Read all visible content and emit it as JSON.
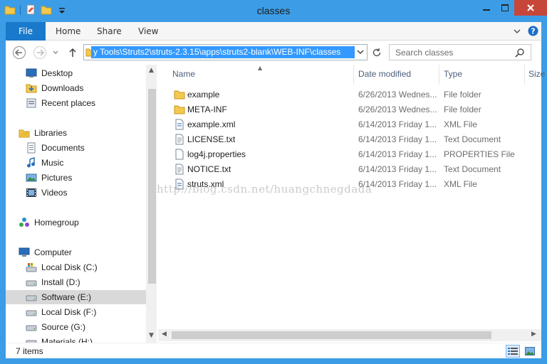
{
  "window": {
    "title": "classes",
    "colors": {
      "frame": "#3c9de6",
      "file_tab": "#1979ca",
      "close": "#c7463a",
      "selection": "#3399ff"
    }
  },
  "ribbon": {
    "tabs": [
      "File",
      "Home",
      "Share",
      "View"
    ]
  },
  "navbar": {
    "address": "y Tools\\Struts2\\struts-2.3.15\\apps\\struts2-blank\\WEB-INF\\classes",
    "search_placeholder": "Search classes"
  },
  "nav_pane": {
    "items": [
      {
        "label": "Desktop",
        "icon": "desktop-icon"
      },
      {
        "label": "Downloads",
        "icon": "downloads-icon"
      },
      {
        "label": "Recent places",
        "icon": "recent-places-icon"
      },
      {
        "label": "Libraries",
        "icon": "libraries-icon"
      },
      {
        "label": "Documents",
        "icon": "documents-icon"
      },
      {
        "label": "Music",
        "icon": "music-icon"
      },
      {
        "label": "Pictures",
        "icon": "pictures-icon"
      },
      {
        "label": "Videos",
        "icon": "videos-icon"
      },
      {
        "label": "Homegroup",
        "icon": "homegroup-icon"
      },
      {
        "label": "Computer",
        "icon": "computer-icon"
      },
      {
        "label": "Local Disk (C:)",
        "icon": "system-drive-icon"
      },
      {
        "label": "Install (D:)",
        "icon": "drive-icon"
      },
      {
        "label": "Software (E:)",
        "icon": "drive-icon",
        "selected": true
      },
      {
        "label": "Local Disk (F:)",
        "icon": "drive-icon"
      },
      {
        "label": "Source (G:)",
        "icon": "drive-icon"
      },
      {
        "label": "Materials (H:)",
        "icon": "drive-icon"
      }
    ]
  },
  "file_list": {
    "columns": [
      "Name",
      "Date modified",
      "Type",
      "Size"
    ],
    "rows": [
      {
        "name": "example",
        "date": "6/26/2013 Wednes...",
        "type": "File folder",
        "icon": "folder-icon"
      },
      {
        "name": "META-INF",
        "date": "6/26/2013 Wednes...",
        "type": "File folder",
        "icon": "folder-icon"
      },
      {
        "name": "example.xml",
        "date": "6/14/2013 Friday 1...",
        "type": "XML File",
        "icon": "xml-file-icon"
      },
      {
        "name": "LICENSE.txt",
        "date": "6/14/2013 Friday 1...",
        "type": "Text Document",
        "icon": "text-file-icon"
      },
      {
        "name": "log4j.properties",
        "date": "6/14/2013 Friday 1...",
        "type": "PROPERTIES File",
        "icon": "file-icon"
      },
      {
        "name": "NOTICE.txt",
        "date": "6/14/2013 Friday 1...",
        "type": "Text Document",
        "icon": "text-file-icon"
      },
      {
        "name": "struts.xml",
        "date": "6/14/2013 Friday 1...",
        "type": "XML File",
        "icon": "xml-file-icon"
      }
    ]
  },
  "status": {
    "item_count": "7 items"
  },
  "watermark": "http://blog.csdn.net/huangchnegdada"
}
